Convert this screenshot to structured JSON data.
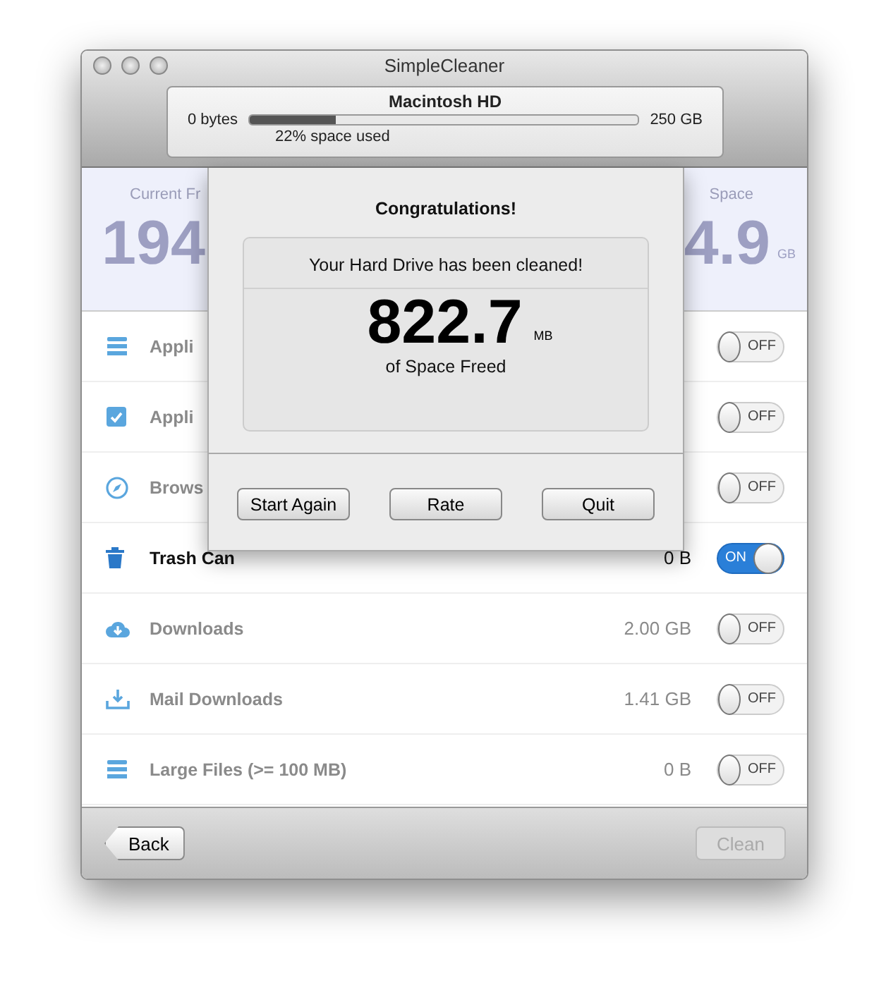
{
  "window": {
    "title": "SimpleCleaner"
  },
  "drive": {
    "name": "Macintosh HD",
    "min": "0 bytes",
    "max": "250 GB",
    "level": 0.22,
    "usage": "22% space used"
  },
  "stats": {
    "left_label": "Current Fr",
    "left_value": "194",
    "right_label": "Space",
    "right_value": "4.9",
    "right_unit": "GB"
  },
  "items": [
    {
      "label": "Appli",
      "on": false,
      "toggle": "OFF"
    },
    {
      "label": "Appli",
      "on": false,
      "toggle": "OFF"
    },
    {
      "label": "Brows",
      "on": false,
      "toggle": "OFF"
    },
    {
      "label": "Trash Can",
      "size": "0 B",
      "on": true,
      "toggle": "ON"
    },
    {
      "label": "Downloads",
      "size": "2.00 GB",
      "on": false,
      "toggle": "OFF"
    },
    {
      "label": "Mail Downloads",
      "size": "1.41 GB",
      "on": false,
      "toggle": "OFF"
    },
    {
      "label": "Large Files (>= 100 MB)",
      "size": "0 B",
      "on": false,
      "toggle": "OFF"
    }
  ],
  "footer": {
    "back": "Back",
    "clean": "Clean",
    "clean_disabled": true
  },
  "dialog": {
    "title": "Congratulations!",
    "message": "Your Hard Drive has been cleaned!",
    "amount": "822.7",
    "unit": "MB",
    "caption": "of Space Freed",
    "buttons": [
      "Start Again",
      "Rate",
      "Quit"
    ]
  }
}
